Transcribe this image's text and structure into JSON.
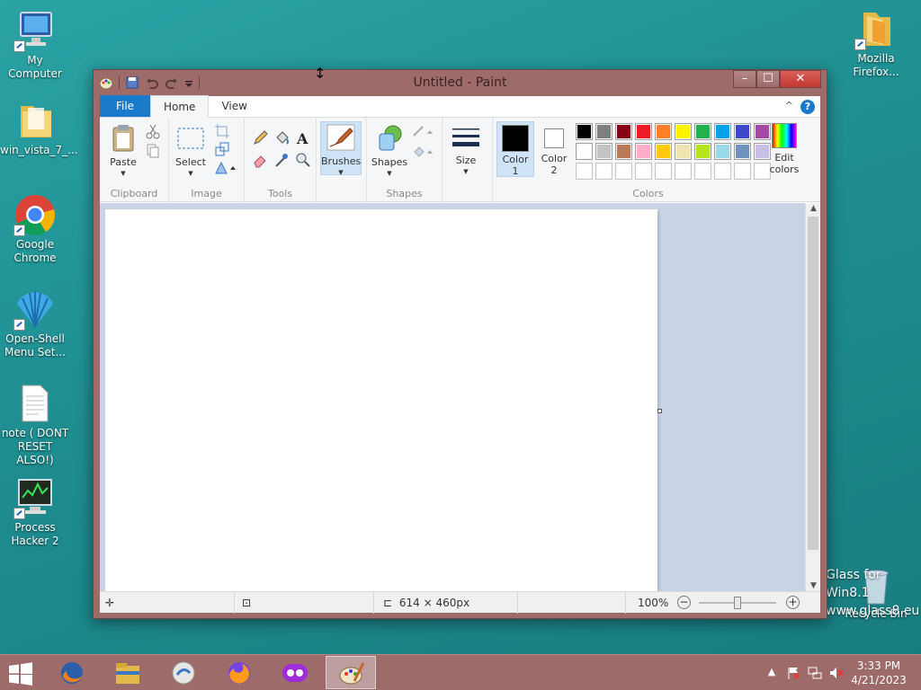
{
  "desktop": {
    "icons": [
      {
        "label": "My Computer"
      },
      {
        "label": "win_vista_7_..."
      },
      {
        "label": "Google Chrome"
      },
      {
        "label": "Open-Shell Menu Set..."
      },
      {
        "label": "note ( DONT RESET ALSO!)"
      },
      {
        "label": "Process Hacker 2"
      },
      {
        "label": "Mozilla Firefox..."
      },
      {
        "label": "Recycle Bin"
      }
    ],
    "watermark": [
      "Glass for Win8.1",
      "www.glass8.eu"
    ]
  },
  "window": {
    "title": "Untitled - Paint",
    "controls": {
      "minimize": "–",
      "maximize": "☐",
      "close": "✕"
    }
  },
  "ribbon": {
    "tabs": [
      {
        "label": "File"
      },
      {
        "label": "Home"
      },
      {
        "label": "View"
      }
    ],
    "help": "?",
    "groups": {
      "clipboard": {
        "label": "Clipboard",
        "paste": "Paste"
      },
      "image": {
        "label": "Image",
        "select": "Select"
      },
      "tools": {
        "label": "Tools"
      },
      "brushes": {
        "label": "Brushes"
      },
      "shapes": {
        "label": "Shapes",
        "button": "Shapes"
      },
      "size": {
        "label": "Size"
      },
      "colors": {
        "label": "Colors",
        "color1_label": "Color",
        "color1_num": "1",
        "color2_label": "Color",
        "color2_num": "2",
        "edit_line1": "Edit",
        "edit_line2": "colors",
        "color1": "#000000",
        "color2": "#ffffff",
        "palette_row1": [
          "#000000",
          "#7f7f7f",
          "#880015",
          "#ed1c24",
          "#ff7f27",
          "#fff200",
          "#22b14c",
          "#00a2e8",
          "#3f48cc",
          "#a349a4"
        ],
        "palette_row2": [
          "#ffffff",
          "#c3c3c3",
          "#b97a57",
          "#ffaec9",
          "#ffc90e",
          "#efe4b0",
          "#b5e61d",
          "#99d9ea",
          "#7092be",
          "#c8bfe7"
        ],
        "palette_row3": [
          "#ffffff",
          "#ffffff",
          "#ffffff",
          "#ffffff",
          "#ffffff",
          "#ffffff",
          "#ffffff",
          "#ffffff",
          "#ffffff",
          "#ffffff"
        ]
      }
    }
  },
  "status": {
    "dimensions": "614 × 460px",
    "zoom": "100%",
    "zoom_out": "−",
    "zoom_in": "+"
  },
  "taskbar": {
    "apps": [
      "firefox-legacy",
      "file-explorer",
      "open-shell-app",
      "firefox",
      "mask-app",
      "paint"
    ],
    "time": "3:33 PM",
    "date": "4/21/2023"
  }
}
